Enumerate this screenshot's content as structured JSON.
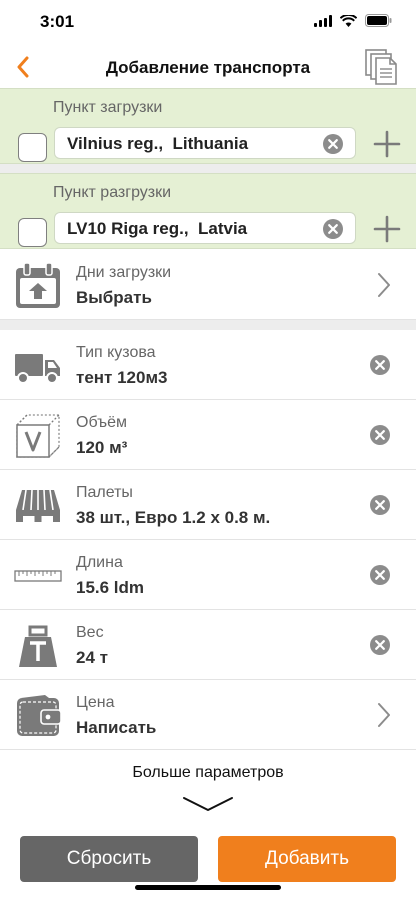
{
  "status": {
    "time": "3:01"
  },
  "nav": {
    "title": "Добавление транспорта"
  },
  "loading": {
    "label": "Пункт загрузки",
    "value": "Vilnius reg.,  Lithuania"
  },
  "unloading": {
    "label": "Пункт разгрузки",
    "value": "LV10 Riga reg.,  Latvia"
  },
  "days": {
    "label": "Дни загрузки",
    "value": "Выбрать"
  },
  "params": [
    {
      "label": "Тип кузова",
      "value": "тент 120м3",
      "icon": "truck-icon"
    },
    {
      "label": "Объём",
      "value": "120 м³",
      "icon": "volume-icon"
    },
    {
      "label": "Палеты",
      "value": "38 шт., Евро 1.2 x 0.8 м.",
      "icon": "pallet-icon"
    },
    {
      "label": "Длина",
      "value": "15.6 ldm",
      "icon": "ruler-icon"
    },
    {
      "label": "Вес",
      "value": "24 т",
      "icon": "weight-icon"
    }
  ],
  "price": {
    "label": "Цена",
    "value": "Написать",
    "icon": "wallet-icon"
  },
  "more": {
    "label": "Больше параметров"
  },
  "buttons": {
    "reset": "Сбросить",
    "add": "Добавить"
  },
  "colors": {
    "accent": "#f07f1d",
    "route_bg": "#e5f0d4",
    "icon_gray": "#7a7a7a",
    "reset_bg": "#666666"
  }
}
